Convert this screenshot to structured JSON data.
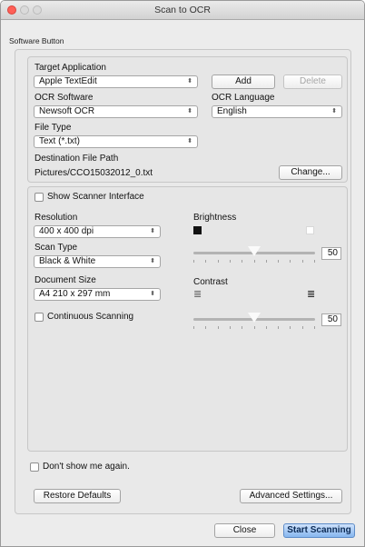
{
  "window": {
    "title": "Scan to OCR"
  },
  "software_button": {
    "tab_label": "Software Button",
    "target_application": {
      "label": "Target Application",
      "value": "Apple TextEdit"
    },
    "add_button": "Add",
    "delete_button": "Delete",
    "ocr_software": {
      "label": "OCR Software",
      "value": "Newsoft OCR"
    },
    "ocr_language": {
      "label": "OCR Language",
      "value": "English"
    },
    "file_type": {
      "label": "File Type",
      "value": "Text (*.txt)"
    },
    "destination": {
      "label": "Destination File Path",
      "value": "Pictures/CCO15032012_0.txt",
      "change_button": "Change..."
    }
  },
  "scanner": {
    "show_scanner_interface": {
      "label": "Show Scanner Interface",
      "checked": false
    },
    "resolution": {
      "label": "Resolution",
      "value": "400 x 400 dpi"
    },
    "scan_type": {
      "label": "Scan Type",
      "value": "Black & White"
    },
    "document_size": {
      "label": "Document Size",
      "value": "A4 210 x 297 mm"
    },
    "continuous_scanning": {
      "label": "Continuous Scanning",
      "checked": false
    },
    "brightness": {
      "label": "Brightness",
      "value": "50",
      "fraction": 0.5
    },
    "contrast": {
      "label": "Contrast",
      "value": "50",
      "fraction": 0.5
    }
  },
  "footer": {
    "dont_show": {
      "label": "Don't show me again.",
      "checked": false
    },
    "restore_defaults": "Restore Defaults",
    "advanced_settings": "Advanced Settings...",
    "close": "Close",
    "start_scanning": "Start Scanning"
  },
  "icons": {
    "popup_arrow": "up-down-arrows-icon"
  },
  "colors": {
    "accent": "#86b6ef",
    "close_light": "#ff5f57"
  }
}
